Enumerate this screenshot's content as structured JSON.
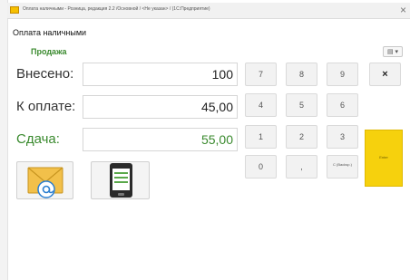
{
  "window": {
    "title": "Оплата наличными - Розница, редакция 2.2 /Основной / <Не указан> / (1С:Предприятие)",
    "close_glyph": "×"
  },
  "form": {
    "title": "Оплата наличными",
    "subtitle": "Продажа",
    "menu_glyph": "▤ ▾"
  },
  "fields": {
    "deposited_label": "Внесено:",
    "deposited_value": "100",
    "to_pay_label": "К оплате:",
    "to_pay_value": "45,00",
    "change_label": "Сдача:",
    "change_value": "55,00"
  },
  "keypad": {
    "k7": "7",
    "k8": "8",
    "k9": "9",
    "clear": "×",
    "k4": "4",
    "k5": "5",
    "k6": "6",
    "k1": "1",
    "k2": "2",
    "k3": "3",
    "k0": "0",
    "comma": ",",
    "backspace": "C (Backsp.)"
  },
  "action": {
    "enter_label": "Enter"
  },
  "icons": {
    "email": "email-icon",
    "phone": "phone-icon",
    "app": "1c-app-icon"
  },
  "colors": {
    "accent_green": "#3a8a2e",
    "enter_yellow": "#f6d10d"
  }
}
